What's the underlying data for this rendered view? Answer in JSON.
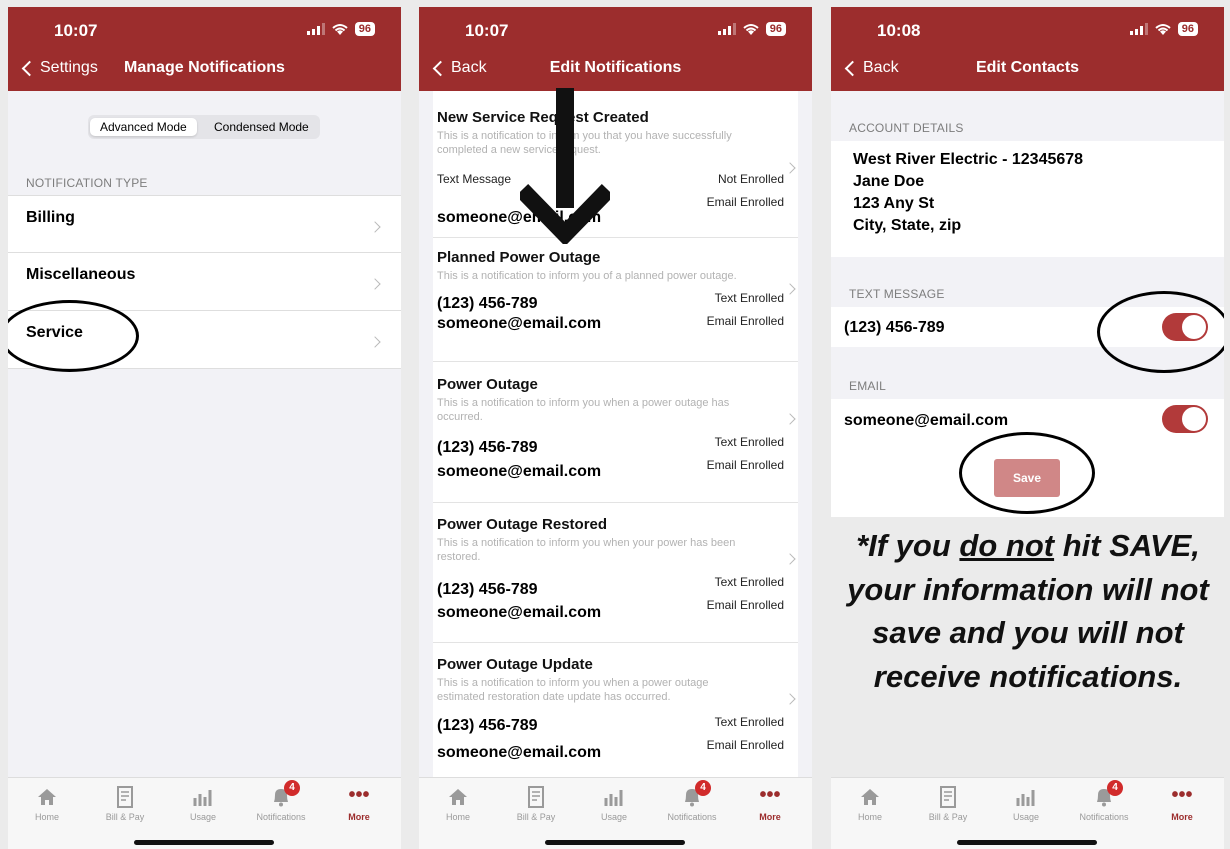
{
  "screens": [
    {
      "time": "10:07",
      "battery": "96",
      "back_label": "Settings",
      "title": "Manage Notifications",
      "segments": [
        "Advanced Mode",
        "Condensed Mode"
      ],
      "section_label": "NOTIFICATION TYPE",
      "items": [
        "Billing",
        "Miscellaneous",
        "Service"
      ]
    },
    {
      "time": "10:07",
      "battery": "96",
      "back_label": "Back",
      "title": "Edit Notifications",
      "notifications": [
        {
          "title": "New Service Request Created",
          "desc": "This is a notification to inform you that you have successfully completed a new service request.",
          "phone": "",
          "email": "someone@email.com",
          "text_status": "Not Enrolled",
          "email_status": "Email Enrolled",
          "text_label": "Text Message"
        },
        {
          "title": "Planned Power Outage",
          "desc": "This is a notification to inform you of a planned power outage.",
          "phone": "(123) 456-789",
          "email": "someone@email.com",
          "text_status": "Text Enrolled",
          "email_status": "Email Enrolled"
        },
        {
          "title": "Power Outage",
          "desc": "This is a notification to inform you when a power outage has occurred.",
          "phone": "(123) 456-789",
          "email": "someone@email.com",
          "text_status": "Text Enrolled",
          "email_status": "Email Enrolled"
        },
        {
          "title": "Power Outage Restored",
          "desc": "This is a notification to inform you when your power has been restored.",
          "phone": "(123) 456-789",
          "email": "someone@email.com",
          "text_status": "Text Enrolled",
          "email_status": "Email Enrolled"
        },
        {
          "title": "Power Outage Update",
          "desc": "This is a notification to inform you when a power outage estimated restoration date update has occurred.",
          "phone": "(123) 456-789",
          "email": "someone@email.com",
          "text_status": "Text Enrolled",
          "email_status": "Email Enrolled"
        }
      ]
    },
    {
      "time": "10:08",
      "battery": "96",
      "back_label": "Back",
      "title": "Edit Contacts",
      "account_label": "ACCOUNT DETAILS",
      "account_lines": [
        "West River Electric - 12345678",
        "Jane Doe",
        "123 Any St",
        "City, State, zip"
      ],
      "text_label": "TEXT MESSAGE",
      "text_value": "(123) 456-789",
      "text_enabled": true,
      "email_label": "EMAIL",
      "email_value": "someone@email.com",
      "email_enabled": true,
      "save_label": "Save"
    }
  ],
  "tabs": [
    {
      "label": "Home",
      "icon": "home-icon"
    },
    {
      "label": "Bill & Pay",
      "icon": "bill-icon"
    },
    {
      "label": "Usage",
      "icon": "usage-icon"
    },
    {
      "label": "Notifications",
      "icon": "bell-icon",
      "badge": "4"
    },
    {
      "label": "More",
      "icon": "more-icon"
    }
  ],
  "warning": {
    "part1": "*If you ",
    "emph": "do not",
    "part2": " hit SAVE, your information will not save and you will not receive notifications."
  },
  "colors": {
    "header": "#9c2d2d",
    "toggle": "#b23a3a",
    "save": "#d08787",
    "badge": "#d12b2b"
  }
}
